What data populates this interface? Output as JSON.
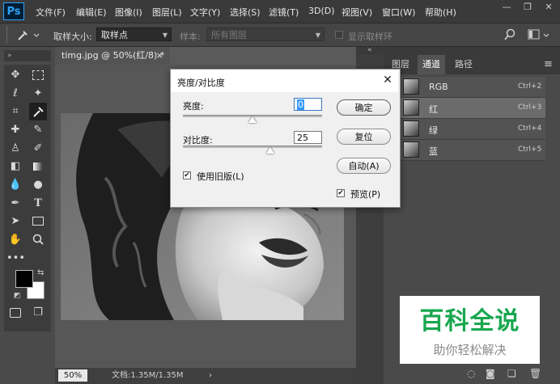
{
  "app": {
    "logo": "Ps"
  },
  "menu": [
    "文件(F)",
    "编辑(E)",
    "图像(I)",
    "图层(L)",
    "文字(Y)",
    "选择(S)",
    "滤镜(T)",
    "3D(D)",
    "视图(V)",
    "窗口(W)",
    "帮助(H)"
  ],
  "window_controls": {
    "minimize": "—",
    "restore": "❐",
    "close": "✕"
  },
  "options_bar": {
    "sample_size_label": "取样大小:",
    "sample_size_value": "取样点",
    "sample_label": "样本:",
    "sample_value": "所有图层",
    "show_ring_label": "显示取样环"
  },
  "document": {
    "tab_title": "timg.jpg @ 50%(红/8) *",
    "tab_close": "×",
    "zoom": "50%",
    "doc_info": "文档:1.35M/1.35M",
    "status_arrow": "›"
  },
  "panel": {
    "tabs": [
      "图层",
      "通道",
      "路径"
    ],
    "active_tab": 1,
    "collapse": "«",
    "menu": "≡",
    "channels": [
      {
        "name": "RGB",
        "shortcut": "Ctrl+2",
        "selected": false
      },
      {
        "name": "红",
        "shortcut": "Ctrl+3",
        "selected": true
      },
      {
        "name": "绿",
        "shortcut": "Ctrl+4",
        "selected": false
      },
      {
        "name": "蓝",
        "shortcut": "Ctrl+5",
        "selected": false
      }
    ]
  },
  "dialog": {
    "title": "亮度/对比度",
    "close": "✕",
    "brightness_label": "亮度:",
    "brightness_value": "0",
    "brightness_level": 0.5,
    "contrast_label": "对比度:",
    "contrast_value": "25",
    "contrast_level": 0.625,
    "legacy_label": "使用旧版(L)",
    "legacy_checked": true,
    "preview_label": "预览(P)",
    "preview_checked": true,
    "ok_label": "确定",
    "reset_label": "复位",
    "auto_label": "自动(A)"
  },
  "watermark": {
    "title": "百科全说",
    "subtitle": "助你轻松解决"
  },
  "colors": {
    "accent": "#2fa3f5",
    "watermark_green": "#18a74f",
    "menubar": "#3a3a3a",
    "panel": "#4a4a4a"
  }
}
